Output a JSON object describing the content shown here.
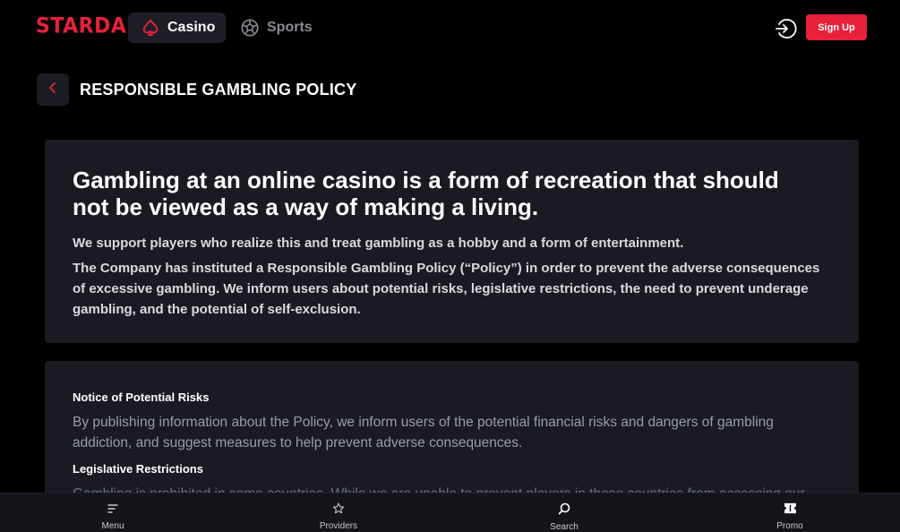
{
  "header": {
    "logo": "STARDA",
    "tabs": [
      {
        "label": "Casino",
        "icon": "spade-icon",
        "active": true
      },
      {
        "label": "Sports",
        "icon": "soccer-ball-icon",
        "active": false
      }
    ],
    "login_icon": "login-icon",
    "signup_label": "Sign Up"
  },
  "page": {
    "title": "RESPONSIBLE GAMBLING POLICY",
    "back_icon": "chevron-left-icon"
  },
  "intro": {
    "heading": "Gambling at an online casino is a form of recreation that should not be viewed as a way of making a living.",
    "paragraphs": [
      "We support players who realize this and treat gambling as a hobby and a form of entertainment.",
      "The Company has instituted a Responsible Gambling Policy (“Policy”) in order to prevent the adverse consequences of excessive gambling. We inform users about potential risks, legislative restrictions, the need to prevent underage gambling, and the potential of self-exclusion."
    ]
  },
  "sections": [
    {
      "title": "Notice of Potential Risks",
      "text": "By publishing information about the Policy, we inform users of the potential financial risks and dangers of gambling addiction, and suggest measures to help prevent adverse consequences."
    },
    {
      "title": "Legislative Restrictions",
      "text": "Gambling is prohibited in some countries. While we are unable to prevent players in these countries from accessing our"
    }
  ],
  "bottom_nav": [
    {
      "label": "Menu",
      "icon": "menu-icon"
    },
    {
      "label": "Providers",
      "icon": "star-icon"
    },
    {
      "label": "Search",
      "icon": "search-icon"
    },
    {
      "label": "Promo",
      "icon": "ticket-icon"
    }
  ],
  "colors": {
    "accent": "#e8213a",
    "background": "#000000",
    "card": "#1a1b22",
    "muted_text": "#9a9ca4"
  }
}
